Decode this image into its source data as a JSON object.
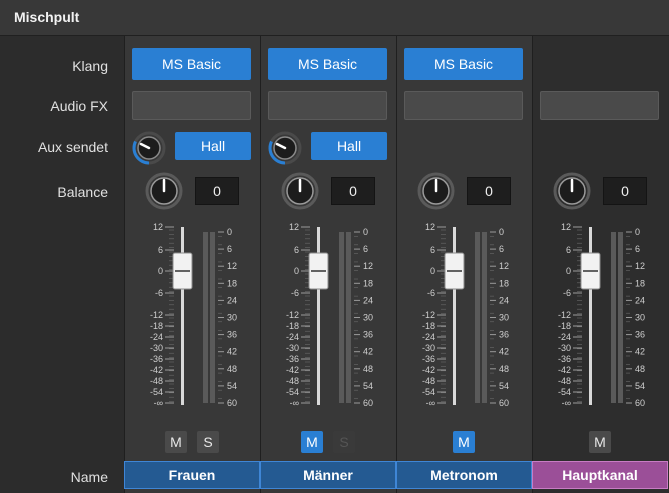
{
  "window": {
    "title": "Mischpult"
  },
  "row_labels": {
    "klang": "Klang",
    "audio_fx": "Audio FX",
    "aux": "Aux sendet",
    "balance": "Balance",
    "name": "Name"
  },
  "colors": {
    "accent": "#2a7fd3",
    "master": "#9b4f98",
    "name_bg": "#245a92"
  },
  "fader_scale": [
    "12",
    "6",
    "0",
    "-6",
    "-12",
    "-18",
    "-24",
    "-30",
    "-36",
    "-42",
    "-48",
    "-54",
    "-∞"
  ],
  "meter_scale": [
    "0",
    "6",
    "12",
    "18",
    "24",
    "30",
    "36",
    "42",
    "48",
    "54",
    "60"
  ],
  "channels": [
    {
      "id": "frauen",
      "name": "Frauen",
      "klang": "MS Basic",
      "aux_label": "Hall",
      "balance": "0",
      "fader_db": 0,
      "mute": "M",
      "mute_active": false,
      "solo": "S",
      "solo_enabled": true
    },
    {
      "id": "maenner",
      "name": "Männer",
      "klang": "MS Basic",
      "aux_label": "Hall",
      "balance": "0",
      "fader_db": 0,
      "mute": "M",
      "mute_active": true,
      "solo": "S",
      "solo_enabled": false
    },
    {
      "id": "metronom",
      "name": "Metronom",
      "klang": "MS Basic",
      "balance": "0",
      "fader_db": 0,
      "mute": "M",
      "mute_active": true
    },
    {
      "id": "hauptkanal",
      "name": "Hauptkanal",
      "balance": "0",
      "fader_db": 0,
      "mute": "M",
      "mute_active": false,
      "master": true
    }
  ]
}
